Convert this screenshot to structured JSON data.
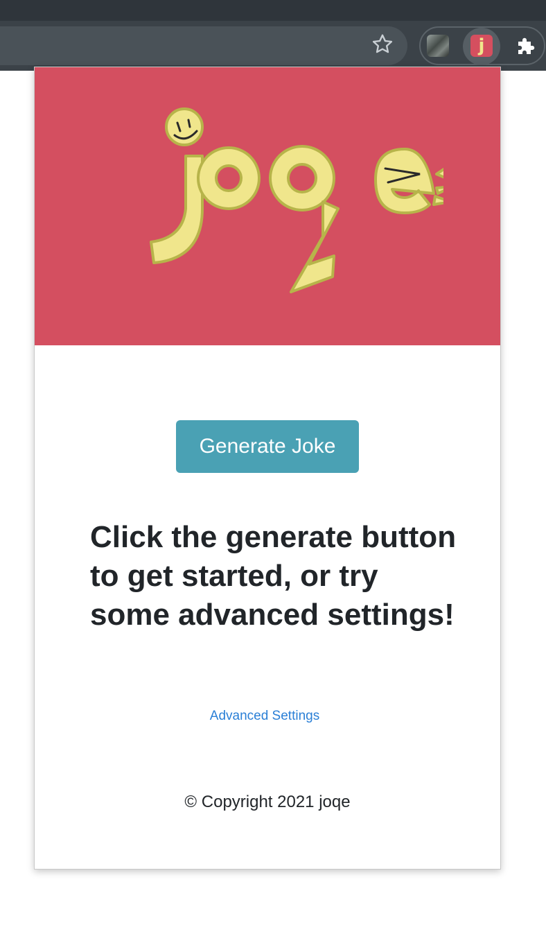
{
  "browser": {
    "bookmark_icon": "star-icon",
    "extensions": [
      {
        "name": "photo-extension-icon"
      },
      {
        "name": "joqe-extension-icon",
        "label": "j"
      },
      {
        "name": "puzzle-icon"
      }
    ]
  },
  "popup": {
    "logo_text": "joqe",
    "generate_label": "Generate Joke",
    "instructions": "Click the generate button to get started, or try some advanced settings!",
    "advanced_link": "Advanced Settings",
    "copyright": "© Copyright 2021 joqe"
  },
  "colors": {
    "hero_bg": "#d44f60",
    "logo_fill": "#f0e68c",
    "logo_outline": "#b7b44a",
    "button_bg": "#4aa1b4",
    "link": "#2a7fd6",
    "text": "#212529"
  }
}
